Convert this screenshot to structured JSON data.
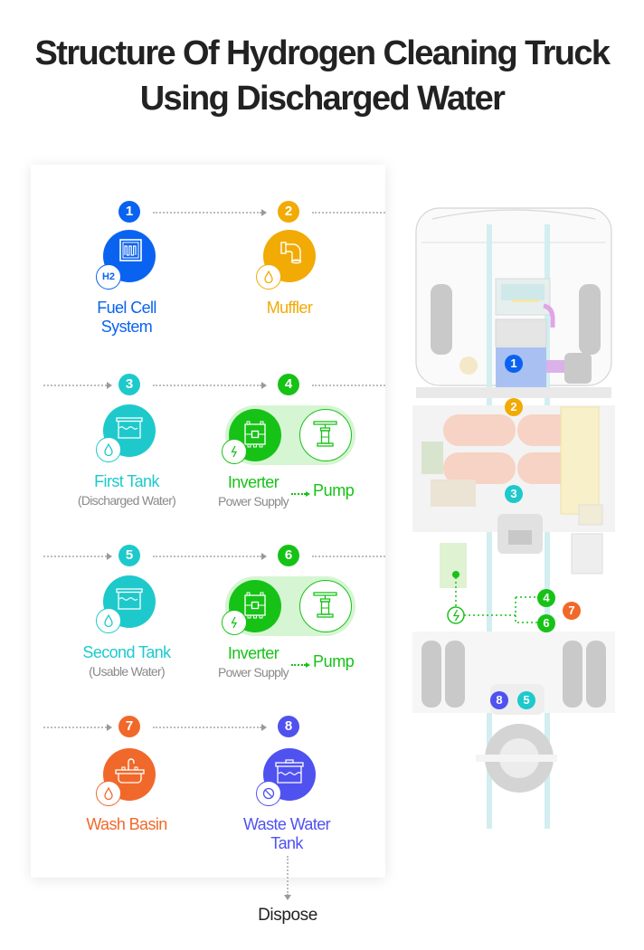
{
  "title": {
    "line1": "Structure Of Hydrogen Cleaning Truck",
    "line2": "Using Discharged Water"
  },
  "colors": {
    "fuel_cell": "#0a63f0",
    "muffler": "#f2aa05",
    "tank": "#1ec9cc",
    "inverter": "#17c217",
    "wash_basin": "#f0692a",
    "waste_tank": "#4f52ef",
    "arrow": "#9a9a9a"
  },
  "steps": [
    {
      "num": "1",
      "label_line1": "Fuel Cell",
      "label_line2": "System",
      "icon": "fuel-cell-icon",
      "sub_icon": "h2-icon",
      "sub_icon_text": "H2"
    },
    {
      "num": "2",
      "label_line1": "Muffler",
      "icon": "pipe-icon",
      "sub_icon": "water-drop-icon"
    },
    {
      "num": "3",
      "label_line1": "First Tank",
      "sublabel": "(Discharged Water)",
      "icon": "tank-icon",
      "sub_icon": "water-drop-icon"
    },
    {
      "num": "4",
      "label_line1": "Inverter",
      "sublabel": "Power Supply",
      "target": "Pump",
      "icon": "inverter-icon",
      "sub_icon": "lightning-icon",
      "target_icon": "pump-icon"
    },
    {
      "num": "5",
      "label_line1": "Second Tank",
      "sublabel": "(Usable Water)",
      "icon": "tank-icon",
      "sub_icon": "water-drop-icon"
    },
    {
      "num": "6",
      "label_line1": "Inverter",
      "sublabel": "Power Supply",
      "target": "Pump",
      "icon": "inverter-icon",
      "sub_icon": "lightning-icon",
      "target_icon": "pump-icon"
    },
    {
      "num": "7",
      "label_line1": "Wash Basin",
      "icon": "sink-icon",
      "sub_icon": "water-drop-icon"
    },
    {
      "num": "8",
      "label_line1": "Waste Water",
      "label_line2": "Tank",
      "icon": "waste-tank-icon",
      "sub_icon": "prohibited-icon"
    }
  ],
  "dispose": "Dispose",
  "truck_markers": [
    "1",
    "2",
    "3",
    "4",
    "5",
    "6",
    "7",
    "8"
  ]
}
